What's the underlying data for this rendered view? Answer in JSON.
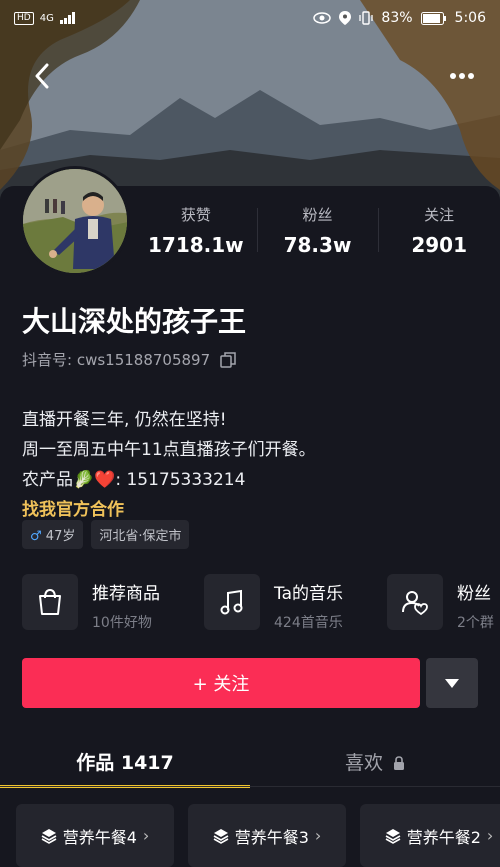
{
  "status": {
    "hd": "HD",
    "network": "4G",
    "battery": "83%",
    "time": "5:06"
  },
  "profile": {
    "name": "大山深处的孩子王",
    "uid_label": "抖音号: cws15188705897",
    "stats": [
      {
        "label": "获赞",
        "value": "1718.1w"
      },
      {
        "label": "粉丝",
        "value": "78.3w"
      },
      {
        "label": "关注",
        "value": "2901"
      }
    ],
    "bio_lines": [
      "直播开餐三年, 仍然在坚持!",
      "周一至周五中午11点直播孩子们开餐。",
      "农产品🥬❤️: 15175333214"
    ],
    "bio_link": "找我官方合作",
    "tags": {
      "gender_symbol": "♂",
      "age": "47岁",
      "location": "河北省·保定市"
    }
  },
  "features": [
    {
      "title": "推荐商品",
      "sub": "10件好物",
      "icon": "bag-icon"
    },
    {
      "title": "Ta的音乐",
      "sub": "424首音乐",
      "icon": "music-icon"
    },
    {
      "title": "粉丝",
      "sub": "2个群",
      "icon": "fans-group-icon"
    }
  ],
  "actions": {
    "follow": "+ 关注"
  },
  "tabs": [
    {
      "label": "作品 1417"
    },
    {
      "label": "喜欢"
    }
  ],
  "collections": [
    {
      "label": "营养午餐4"
    },
    {
      "label": "营养午餐3"
    },
    {
      "label": "营养午餐2"
    }
  ],
  "colors": {
    "accent": "#fb2d55",
    "tab_indicator": "#f0c42d",
    "link": "#f0c25a"
  }
}
